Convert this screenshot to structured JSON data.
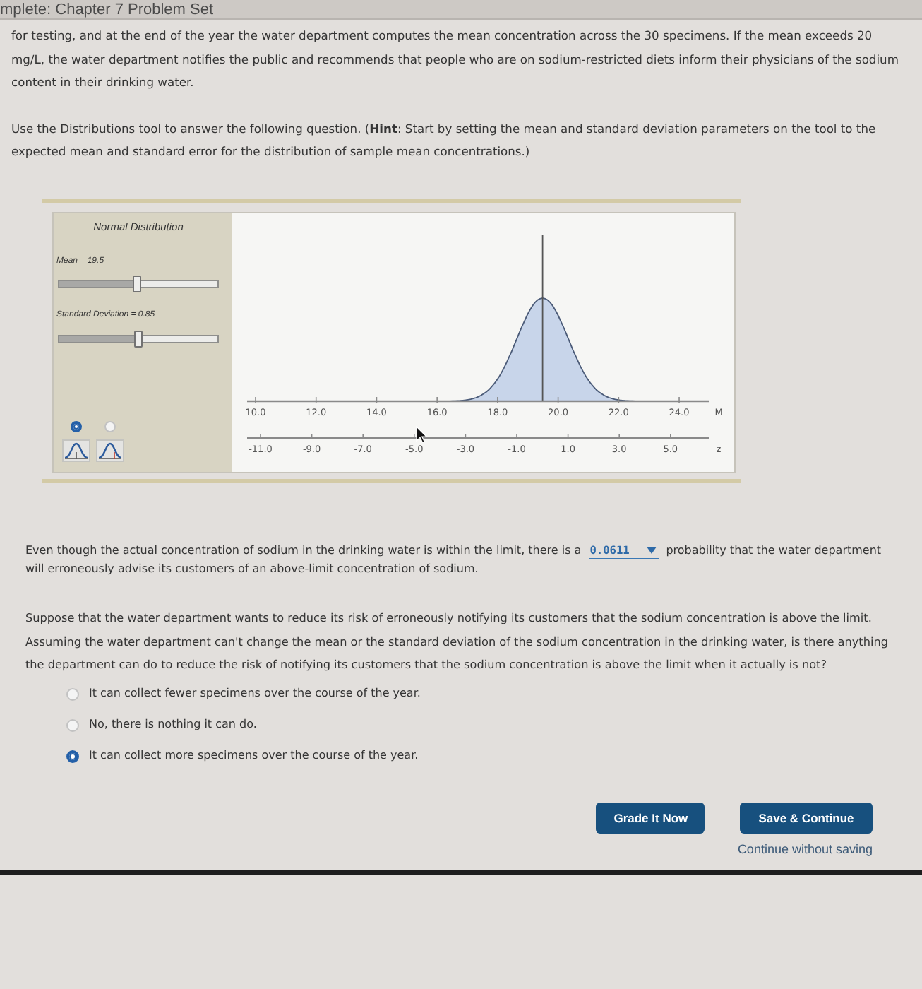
{
  "header": {
    "title": "mplete: Chapter 7 Problem Set"
  },
  "intro": [
    "for testing, and at the end of the year the water department computes the mean concentration across the 30 specimens. If the mean exceeds 20 mg/L, the water department notifies the public and recommends that people who are on sodium-restricted diets inform their physicians of the sodium content in their drinking water.",
    "Use the Distributions tool to answer the following question. (**Hint**: Start by setting the mean and standard deviation parameters on the tool to the expected mean and standard error for the distribution of sample mean concentrations.)"
  ],
  "tool": {
    "title": "Normal Distribution",
    "sliders": [
      {
        "label": "Mean = 19.5",
        "level": 0.49
      },
      {
        "label": "Standard Deviation = 0.85",
        "level": 0.5
      }
    ],
    "views": [
      {
        "selected": true
      },
      {
        "selected": false
      }
    ],
    "m_axis": {
      "label": "M",
      "ticks": [
        "10.0",
        "12.0",
        "14.0",
        "16.0",
        "18.0",
        "20.0",
        "22.0",
        "24.0"
      ]
    },
    "z_axis": {
      "label": "z",
      "ticks": [
        "-11.0",
        "-9.0",
        "-7.0",
        "-5.0",
        "-3.0",
        "-1.0",
        "1.0",
        "3.0",
        "5.0"
      ]
    }
  },
  "question_1": {
    "text_before": "Even though the actual concentration of sodium in the drinking water is within the limit, there is a",
    "answer": {
      "value": "0.0611"
    },
    "text_after": "probability that the water department",
    "text_continued": "will erroneously advise its customers of an above-limit concentration of sodium."
  },
  "question_2": {
    "prompt": "Suppose that the water department wants to reduce its risk of erroneously notifying its customers that the sodium concentration is above the limit. Assuming the water department can't change the mean or the standard deviation of the sodium concentration in the drinking water, is there anything the department can do to reduce the risk of notifying its customers that the sodium concentration is above the limit when it actually is not?",
    "options": [
      {
        "label": "It can collect fewer specimens over the course of the year.",
        "selected": false
      },
      {
        "label": "No, there is nothing it can do.",
        "selected": false
      },
      {
        "label": "It can collect more specimens over the course of the year.",
        "selected": true
      }
    ]
  },
  "actions": {
    "grade_button": "Grade It Now",
    "save_button": "Save & Continue",
    "skip_link": "Continue without saving"
  }
}
